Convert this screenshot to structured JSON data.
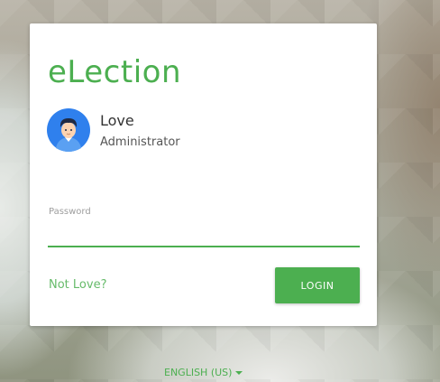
{
  "brand": {
    "title": "eLection"
  },
  "user": {
    "name": "Love",
    "role": "Administrator"
  },
  "password": {
    "label": "Password",
    "value": ""
  },
  "actions": {
    "not_user_link": "Not Love?",
    "login_label": "LOGIN"
  },
  "footer": {
    "language": "ENGLISH (US)"
  },
  "colors": {
    "accent": "#4caf50",
    "avatar_bg": "#2f80ed"
  },
  "icons": {
    "avatar": "user-avatar-icon",
    "language_caret": "caret-down-icon"
  }
}
